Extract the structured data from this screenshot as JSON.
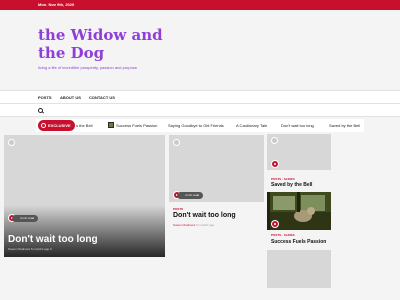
{
  "topbar": {
    "date": "Mon. Nov 9th, 2020"
  },
  "site": {
    "title_line1": "the Widow and",
    "title_line2": "the Dog",
    "tagline": "living a life of incredible prosperity, passion and purpose"
  },
  "nav": {
    "items": [
      "POSTS",
      "ABOUT US",
      "CONTACT US"
    ]
  },
  "ticker": {
    "label": "EXCLUSIVE",
    "items": [
      "s the Bell",
      "Success Fuels Passion",
      "Saying Goodbye to Old Friends",
      "A Cautionary Tale",
      "Don't wait too long",
      "Saved by the Bell"
    ]
  },
  "featured": {
    "pill": "4 min read",
    "title": "Don't wait too long",
    "meta": "Susan Chalmers  5 months ago  0"
  },
  "middle": {
    "pill": "4 min read",
    "category": "POSTS",
    "title": "Don't wait too long",
    "author": "Susan Chalmers",
    "time": "5 months ago"
  },
  "side": [
    {
      "category": "POSTS · SLIDES",
      "title": "Saved by the Bell"
    },
    {
      "category": "POSTS · SLIDES",
      "title": "Success Fuels Passion"
    }
  ],
  "colors": {
    "accent": "#c8102e",
    "brand": "#8f3fd8"
  }
}
